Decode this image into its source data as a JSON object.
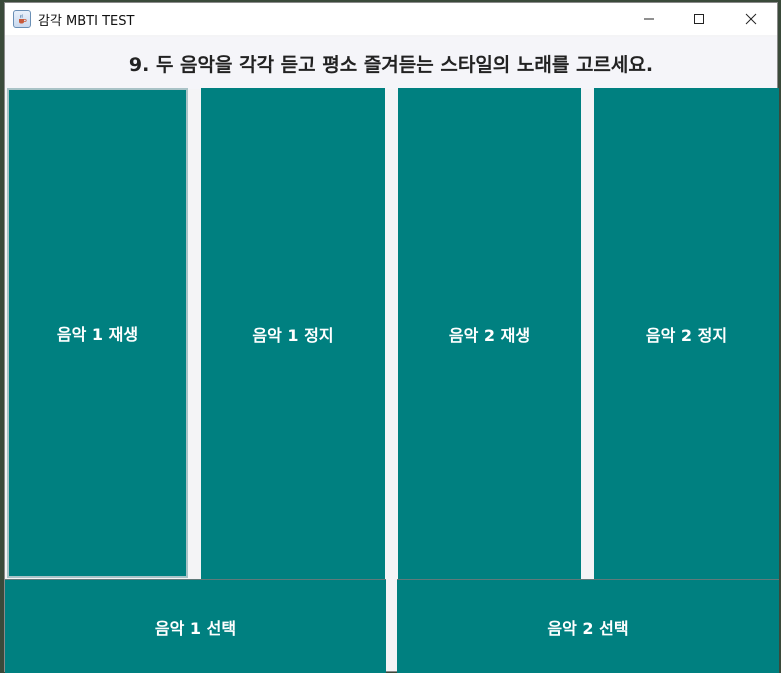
{
  "window": {
    "title": "감각 MBTI TEST",
    "app_icon": "java-coffee-cup-icon"
  },
  "question": "9. 두 음악을 각각 듣고 평소 즐겨듣는 스타일의 노래를 고르세요.",
  "buttons": {
    "play1": "음악 1 재생",
    "stop1": "음악 1 정지",
    "play2": "음악 2 재생",
    "stop2": "음악 2 정지",
    "select1": "음악 1 선택",
    "select2": "음악 2 선택"
  },
  "colors": {
    "button_bg": "#008080",
    "button_text": "#ffffff"
  }
}
